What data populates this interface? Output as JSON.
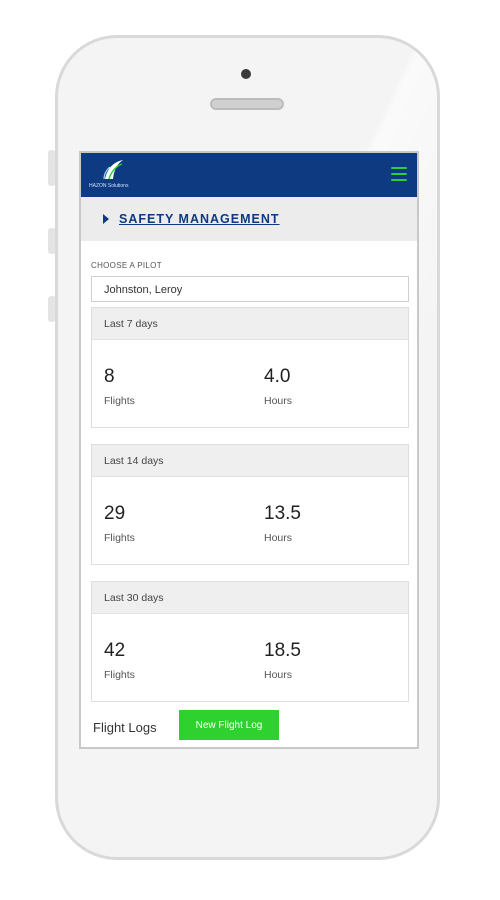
{
  "app": {
    "brand_text": "HAZON Solutions",
    "colors": {
      "navbar": "#0d3a80",
      "accent": "#2fd12f"
    },
    "icons": {
      "menu": "hamburger-icon",
      "section": "caret-right-icon"
    }
  },
  "section": {
    "title": "SAFETY MANAGEMENT"
  },
  "pilot": {
    "label": "CHOOSE A PILOT",
    "value": "Johnston, Leroy"
  },
  "stats": [
    {
      "period": "Last 7 days",
      "flights": "8",
      "flights_label": "Flights",
      "hours": "4.0",
      "hours_label": "Hours"
    },
    {
      "period": "Last 14 days",
      "flights": "29",
      "flights_label": "Flights",
      "hours": "13.5",
      "hours_label": "Hours"
    },
    {
      "period": "Last 30 days",
      "flights": "42",
      "flights_label": "Flights",
      "hours": "18.5",
      "hours_label": "Hours"
    }
  ],
  "flight_logs": {
    "title": "Flight Logs",
    "new_button": "New Flight Log"
  }
}
